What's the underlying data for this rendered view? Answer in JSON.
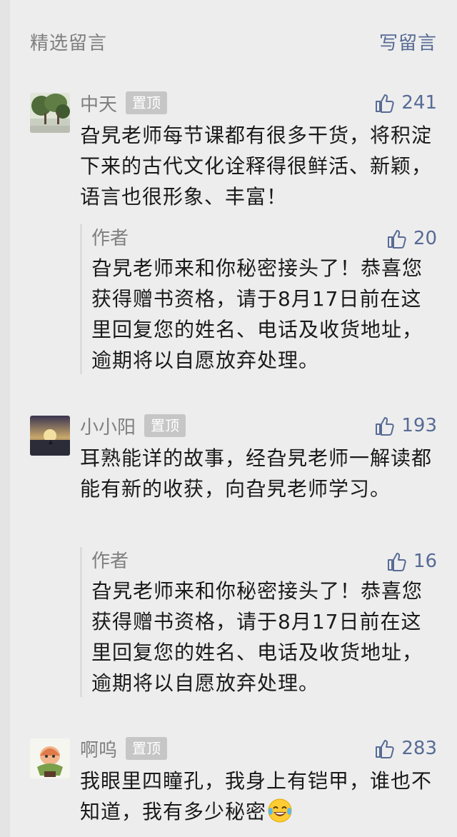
{
  "header": {
    "title": "精选留言",
    "write_label": "写留言"
  },
  "pin_label": "置顶",
  "comments": [
    {
      "name": "中天",
      "likes": "241",
      "text": "旮旯老师每节课都有很多干货，将积淀下来的古代文化诠释得很鲜活、新颖，语言也很形象、丰富！",
      "reply": {
        "author": "作者",
        "likes": "20",
        "text": "旮旯老师来和你秘密接头了！恭喜您获得赠书资格，请于8月17日前在这里回复您的姓名、电话及收货地址，逾期将以自愿放弃处理。"
      }
    },
    {
      "name": "小小阳",
      "likes": "193",
      "text": "耳熟能详的故事，经旮旯老师一解读都能有新的收获，向旮旯老师学习。",
      "reply": {
        "author": "作者",
        "likes": "16",
        "text": "旮旯老师来和你秘密接头了！恭喜您获得赠书资格，请于8月17日前在这里回复您的姓名、电话及收货地址，逾期将以自愿放弃处理。"
      }
    },
    {
      "name": "啊呜",
      "likes": "283",
      "text": "我眼里四瞳孔，我身上有铠甲，谁也不知道，我有多少秘密"
    }
  ],
  "colors": {
    "background": "#ededed",
    "link": "#576b95",
    "meta": "#7f7f7f",
    "pin_badge": "#c6c6c6"
  },
  "icons": {
    "like": "thumbs-up-icon",
    "emoji": "laughing-tears-emoji-icon"
  }
}
